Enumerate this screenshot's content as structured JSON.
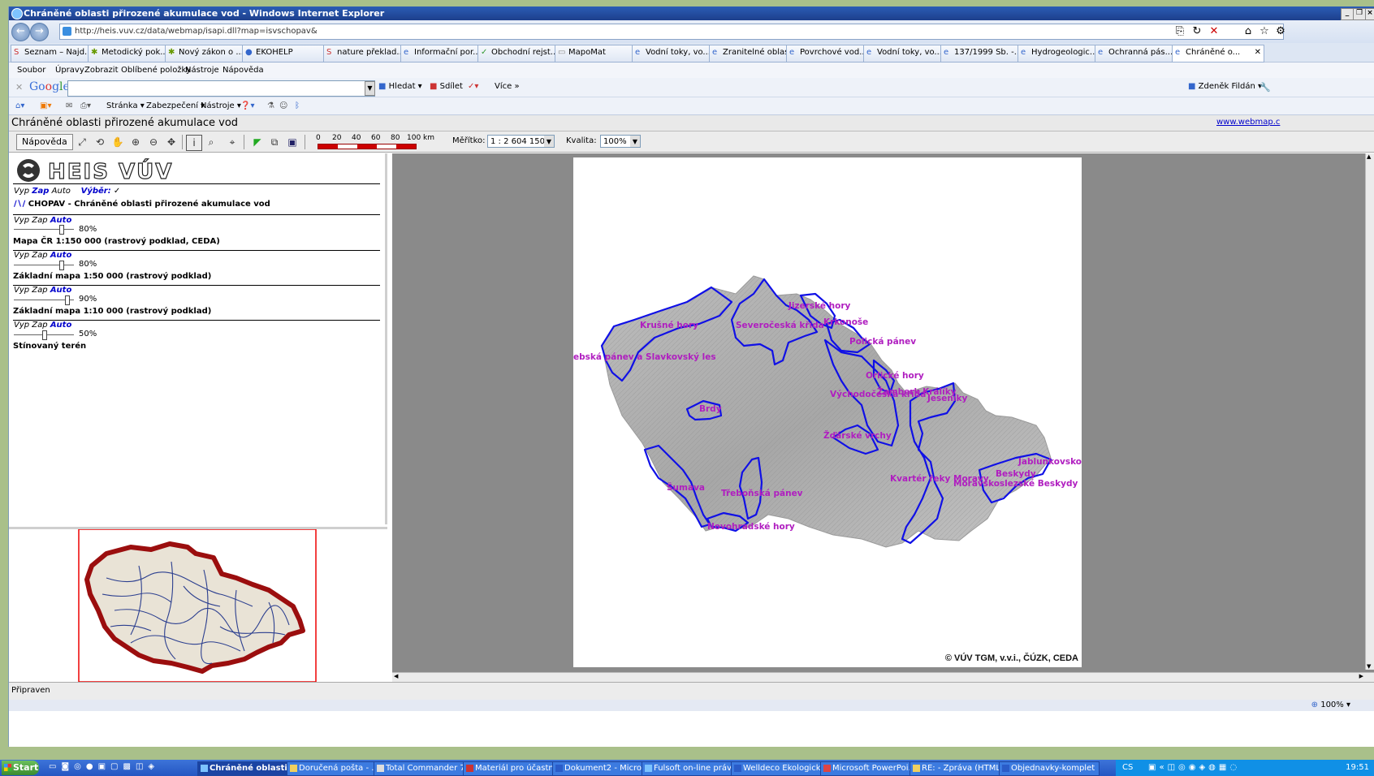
{
  "window": {
    "title": "Chráněné oblasti přirozené akumulace vod - Windows Internet Explorer",
    "address": "http://heis.vuv.cz/data/webmap/isapi.dll?map=isvschopav&"
  },
  "favorites": [
    "Seznam – Najd...",
    "Metodický pok...",
    "Nový zákon o ...",
    "EKOHELP",
    "nature překlad...",
    "Informační por...",
    "Obchodní rejst...",
    "MapoMat",
    "Vodní toky, vo...",
    "Zranitelné oblasti",
    "Povrchové vod...",
    "Vodní toky, vo...",
    "137/1999 Sb. -...",
    "Hydrogeologic...",
    "Ochranná pás...",
    "Chráněné o..."
  ],
  "menu": [
    "Soubor",
    "Úpravy",
    "Zobrazit",
    "Oblíbené položky",
    "Nástroje",
    "Nápověda"
  ],
  "google": {
    "search_label": "Hledat",
    "share_label": "Sdílet",
    "more_label": "Více »",
    "user": "Zdeněk Fildán"
  },
  "command_bar": [
    "Stránka",
    "Zabezpečení",
    "Nástroje"
  ],
  "page": {
    "title": "Chráněné oblasti přirozené akumulace vod",
    "link": "www.webmap.c"
  },
  "toolbar": {
    "help_label": "Nápověda",
    "scale_ticks": [
      "0",
      "20",
      "40",
      "60",
      "80",
      "100 km"
    ],
    "scale_label": "Měřítko:",
    "scale_value": "1 : 2 604 150",
    "quality_label": "Kvalita:",
    "quality_value": "100%"
  },
  "legend": {
    "logo_text": "HEIS VÚV",
    "top_controls": {
      "vyp": "Vyp",
      "zap": "Zap",
      "auto": "Auto",
      "vyber": "Výběr:",
      "check": "✓"
    },
    "chopav_label": "CHOPAV - Chráněné oblasti přirozené akumulace vod",
    "layers": [
      {
        "vyp": "Vyp",
        "zap": "Zap",
        "auto": "Auto",
        "opacity": "80%",
        "name": "Mapa ČR 1:150 000 (rastrový podklad, CEDA)"
      },
      {
        "vyp": "Vyp",
        "zap": "Zap",
        "auto": "Auto",
        "opacity": "80%",
        "name": "Základní mapa 1:50 000 (rastrový podklad)"
      },
      {
        "vyp": "Vyp",
        "zap": "Zap",
        "auto": "Auto",
        "opacity": "90%",
        "name": "Základní mapa 1:10 000 (rastrový podklad)"
      },
      {
        "vyp": "Vyp",
        "zap": "Zap",
        "auto": "Auto",
        "opacity": "50%",
        "name": "Stínovaný terén"
      }
    ]
  },
  "map": {
    "labels": [
      "Jizerské hory",
      "Krkonoše",
      "Krušné hory",
      "Severočeská křída",
      "Polická pánev",
      "ebská pánev a Slavkovský les",
      "Orlické hory",
      "Východočeská křída",
      "Žamberk Králíky",
      "Jeseníky",
      "Brdy",
      "Žďárské vrchy",
      "Beskydy",
      "Jablunkovsko",
      "Kvartér řeky Moravy",
      "Šumava",
      "Třeboňská pánev",
      "Novohradské hory",
      "Moravskoslezské Beskydy"
    ],
    "copyright": "© VÚV TGM, v.v.i., ČÚZK, CEDA"
  },
  "status": {
    "text": "Připraven",
    "zoom": "100%"
  },
  "taskbar": {
    "start": "Start",
    "tasks": [
      "Chráněné oblasti...",
      "Doručená pošta - ...",
      "Total Commander 7...",
      "Materiál pro účastní...",
      "Dokument2 - Micros...",
      "Fulsoft on-line práv...",
      "Welldeco Ekologick...",
      "Microsoft PowerPoi...",
      "RE: - Zpráva (HTML)",
      "Objednavky-komplet"
    ],
    "lang": "CS",
    "time": "19:51"
  }
}
